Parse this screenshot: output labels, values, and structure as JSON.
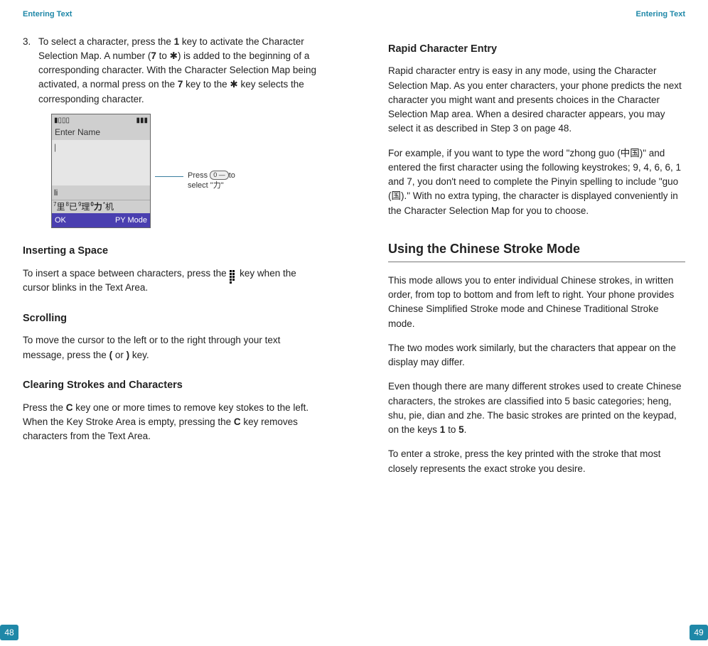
{
  "left": {
    "running_head": "Entering Text",
    "page_num": "48",
    "step3_num": "3.",
    "step3_body_pre": "To select a character, press the ",
    "step3_body_key1": "1",
    "step3_body_mid1": " key to activate the Character Selection Map. A number (",
    "step3_body_key7": "7",
    "step3_body_to": " to ",
    "step3_body_star1": "✱",
    "step3_body_mid2": ") is added to the beginning of a corresponding character. With the Character Selection Map being activated, a normal press on the ",
    "step3_body_key7b": "7",
    "step3_body_mid3": " key to the ",
    "step3_body_star2": "✱",
    "step3_body_end": " key selects the corresponding character.",
    "phone": {
      "enter_name": "Enter Name",
      "cursor": "|",
      "input_li": "li",
      "cands": {
        "c1_sup": "7",
        "c1": "里",
        "c2_sup": "8",
        "c2": "已",
        "c3_sup": "9",
        "c3": "理",
        "c4_sup": "0",
        "c4": "力",
        "c5_sup": "*",
        "c5": "机"
      },
      "sk_left": "OK",
      "sk_right": "PY Mode"
    },
    "callout_pre": "Press ",
    "callout_key": "0 —",
    "callout_mid": "to select \"",
    "callout_char": "力",
    "callout_end": "\"",
    "space_head": "Inserting a Space",
    "space_p_pre": "To insert a space between characters, press the ",
    "space_p_post": " key when the cursor blinks in the Text Area.",
    "scroll_head": "Scrolling",
    "scroll_p_pre": "To move the cursor to the left or to the right through your text message, press the ",
    "scroll_lparen": "(",
    "scroll_or": " or ",
    "scroll_rparen": ")",
    "scroll_p_post": " key.",
    "clear_head": "Clearing Strokes and Characters",
    "clear_p_pre": "Press the ",
    "clear_c1": "C",
    "clear_p_mid": " key one or more times to remove key stokes to the left. When the Key Stroke Area is empty, pressing the ",
    "clear_c2": "C",
    "clear_p_end": " key removes characters from the Text Area."
  },
  "right": {
    "running_head": "Entering Text",
    "page_num": "49",
    "rapid_head": "Rapid Character Entry",
    "rapid_p1": "Rapid character entry is easy in any mode, using the Character Selection Map. As you enter characters, your phone predicts the next character you might want and presents choices in the Character Selection Map area. When a desired character appears, you may select it as described in Step 3 on page 48.",
    "rapid_p2_pre": "For example, if you want to type the word \"zhong guo (",
    "rapid_zhongguo": "中国",
    "rapid_p2_mid1": ")\" and entered the first character using the following keystrokes; 9, 4, 6, 6, 1 and 7, you don't need to complete the Pinyin spelling to include \"guo (",
    "rapid_guo": "国",
    "rapid_p2_mid2": ").\" With no extra typing, the character is displayed conveniently in the Character Selection Map for you to choose.",
    "stroke_h1": "Using the Chinese Stroke Mode",
    "stroke_p1": "This mode allows you to enter individual Chinese strokes, in written order, from top to bottom and from left to right. Your phone provides Chinese Simplified Stroke mode and Chinese Traditional Stroke mode.",
    "stroke_p2": "The two modes work similarly, but the characters that appear on the display may differ.",
    "stroke_p3_pre": "Even though there are many different strokes used to create Chinese characters, the strokes are classified into 5 basic categories; heng, shu, pie, dian and zhe. The basic strokes are printed on the keypad, on the keys ",
    "stroke_k1": "1",
    "stroke_to": " to ",
    "stroke_k5": "5",
    "stroke_p3_post": ".",
    "stroke_p4": "To enter a stroke, press the key printed with the stroke that most closely represents the exact stroke you desire."
  }
}
